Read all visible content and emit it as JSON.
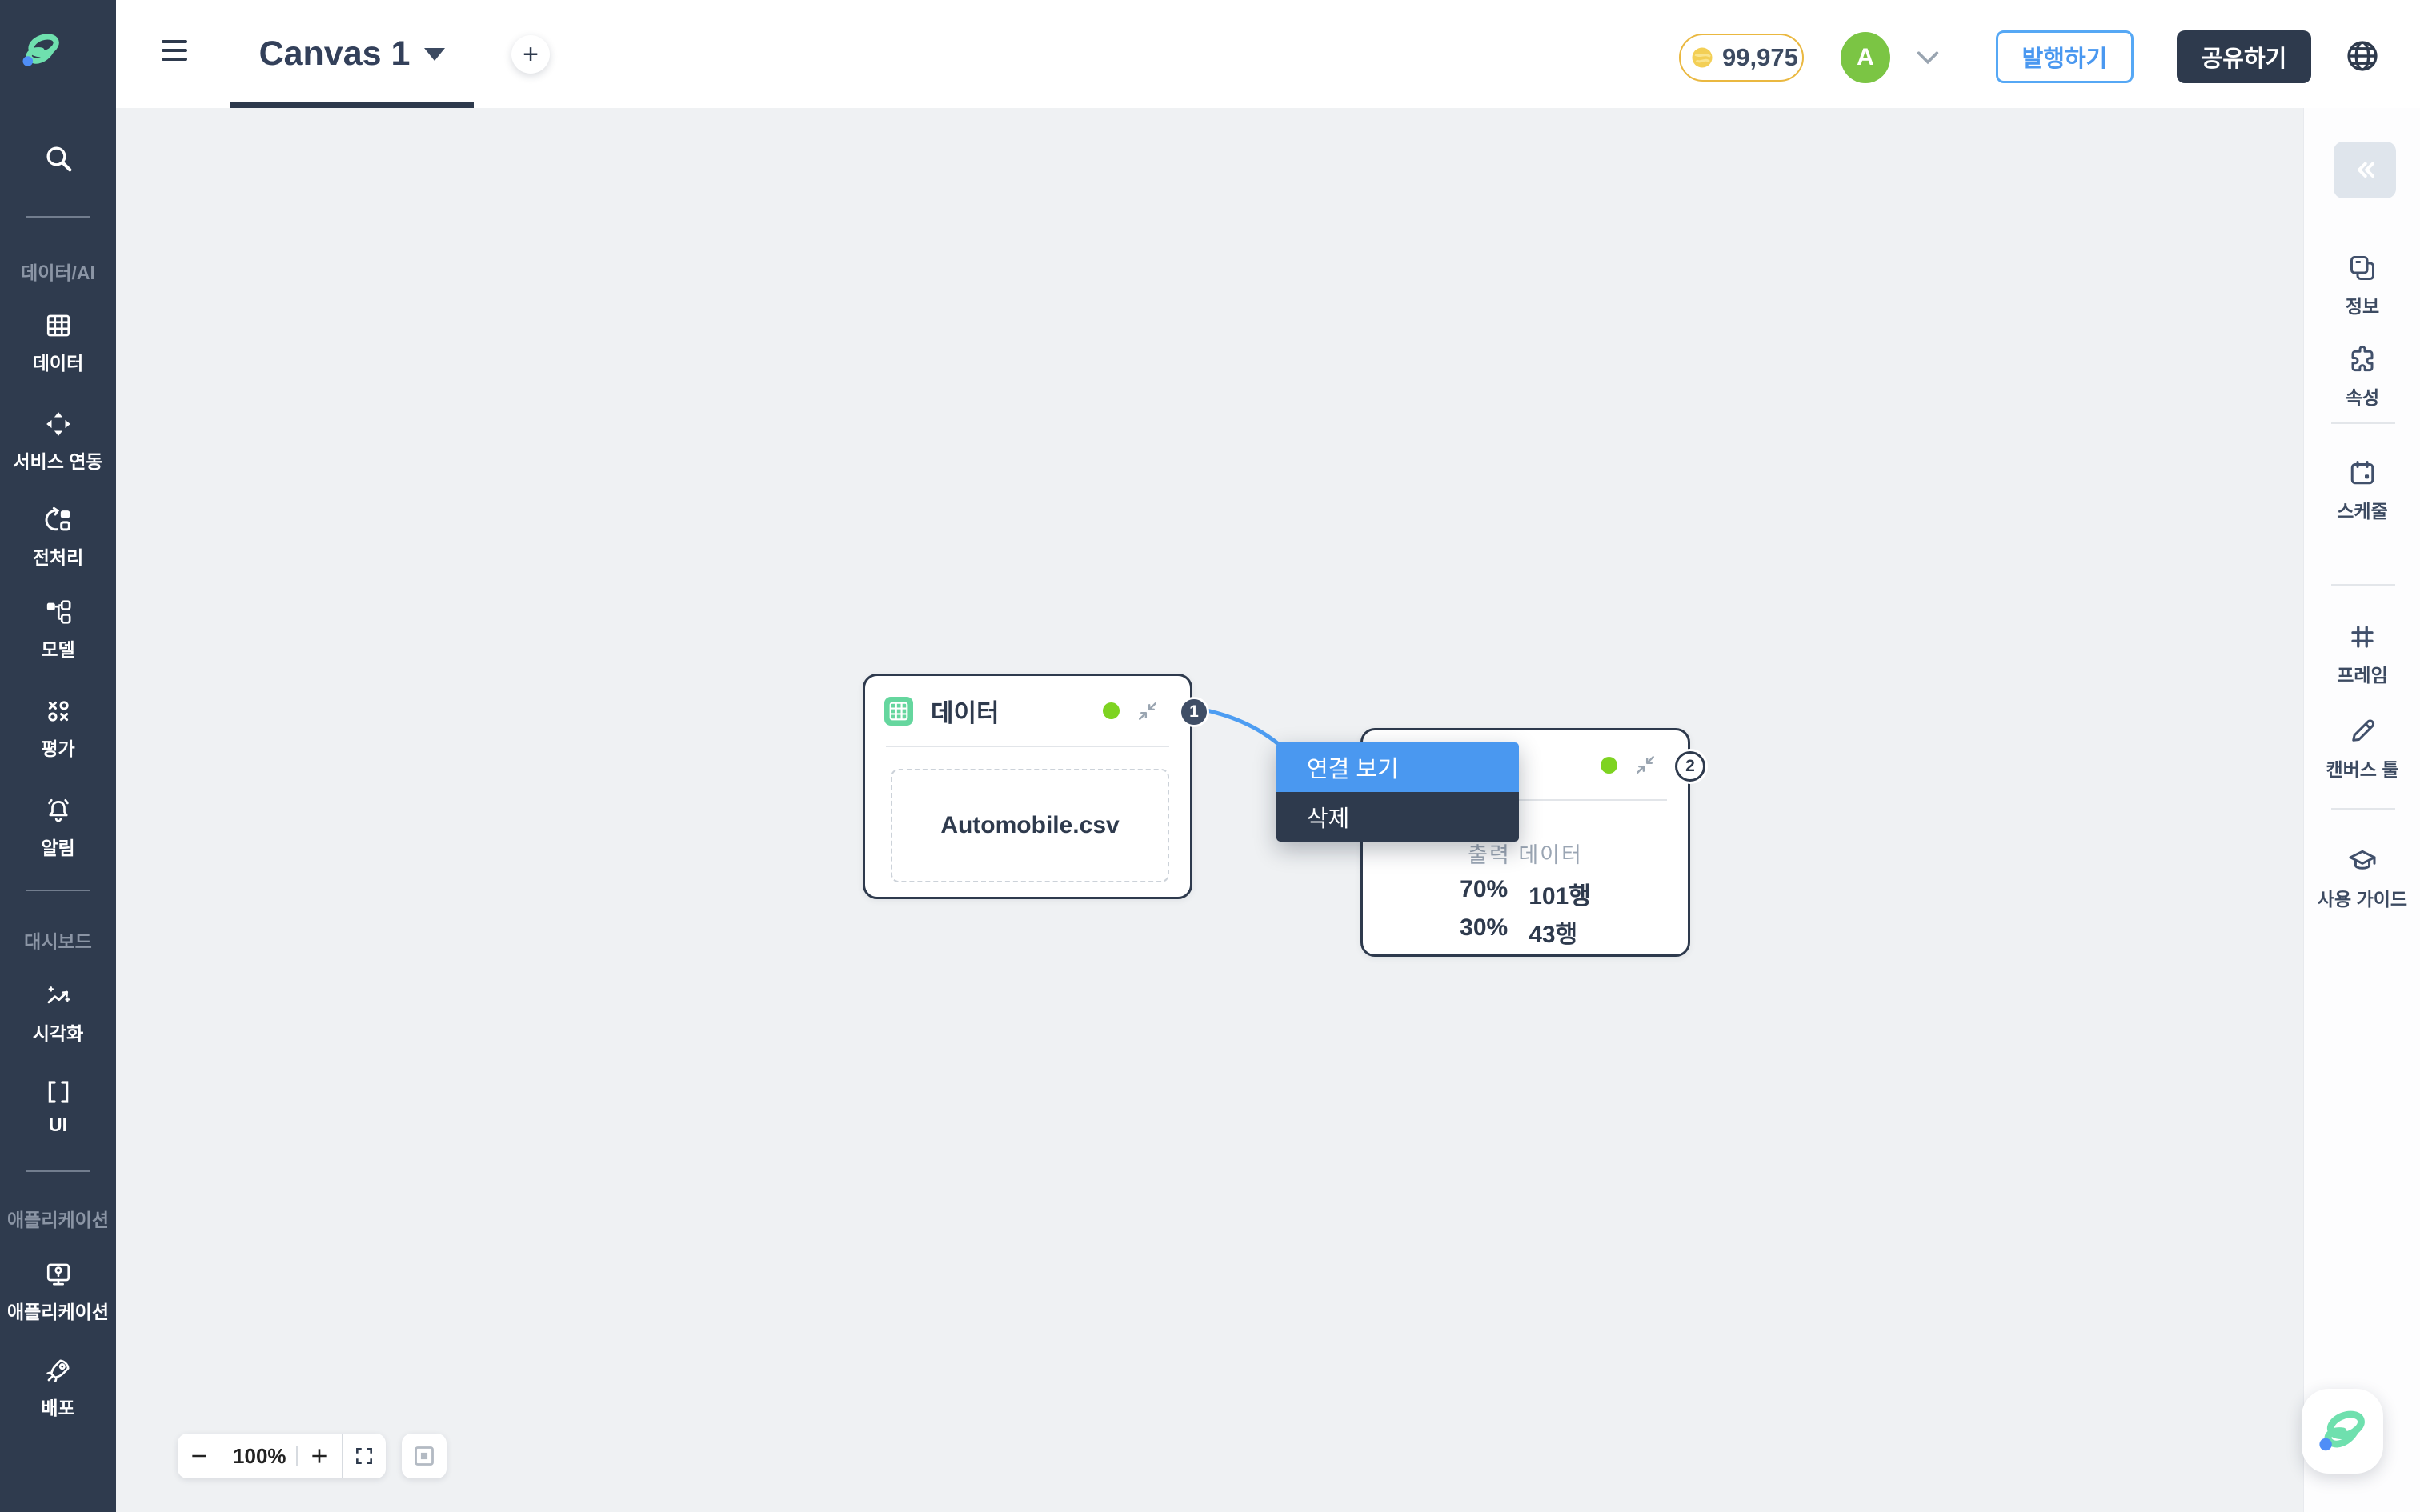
{
  "colors": {
    "sidebar_bg": "#2f3b4e",
    "topbar_bg": "#ffffff",
    "canvas_bg": "#eff1f3",
    "panel_bg": "#fdfdfe",
    "navy": "#2e3a4d",
    "accent_blue": "#4a98f0",
    "edge_blue": "#4d9df2",
    "mint": "#65d69e",
    "status_green": "#7ed321",
    "avatar_green": "#7bc544",
    "coin_gold": "#eab840"
  },
  "topbar": {
    "tab_title": "Canvas 1",
    "coins": "99,975",
    "avatar_initial": "A",
    "publish_label": "발행하기",
    "share_label": "공유하기"
  },
  "left_sidebar": {
    "sections": [
      {
        "label": "데이터/AI"
      },
      {
        "label": "대시보드"
      },
      {
        "label": "애플리케이션"
      }
    ],
    "items": [
      {
        "label": "데이터",
        "icon": "table-grid-icon"
      },
      {
        "label": "서비스 연동",
        "icon": "service-link-icon"
      },
      {
        "label": "전처리",
        "icon": "preprocess-icon"
      },
      {
        "label": "모델",
        "icon": "model-icon"
      },
      {
        "label": "평가",
        "icon": "evaluate-icon"
      },
      {
        "label": "알림",
        "icon": "bell-icon"
      },
      {
        "label": "시각화",
        "icon": "chart-icon"
      },
      {
        "label": "UI",
        "icon": "brackets-icon"
      },
      {
        "label": "애플리케이션",
        "icon": "app-icon"
      },
      {
        "label": "배포",
        "icon": "rocket-icon"
      }
    ]
  },
  "right_sidebar": {
    "items": [
      {
        "label": "정보",
        "icon": "windows-icon"
      },
      {
        "label": "속성",
        "icon": "puzzle-icon"
      },
      {
        "label": "스케줄",
        "icon": "calendar-icon"
      },
      {
        "label": "프레임",
        "icon": "frame-icon"
      },
      {
        "label": "캔버스 툴",
        "icon": "pencil-icon"
      },
      {
        "label": "사용 가이드",
        "icon": "graduation-cap-icon"
      }
    ]
  },
  "canvas": {
    "zoom_level": "100%",
    "node1": {
      "title": "데이터",
      "badge": "1",
      "file_name": "Automobile.csv"
    },
    "node2": {
      "badge": "2",
      "output_label": "출력 데이터",
      "split": [
        {
          "percent": "70%",
          "rows": "101행"
        },
        {
          "percent": "30%",
          "rows": "43행"
        }
      ]
    },
    "context_menu": {
      "items": [
        {
          "label": "연결 보기"
        },
        {
          "label": "삭제"
        }
      ]
    }
  }
}
